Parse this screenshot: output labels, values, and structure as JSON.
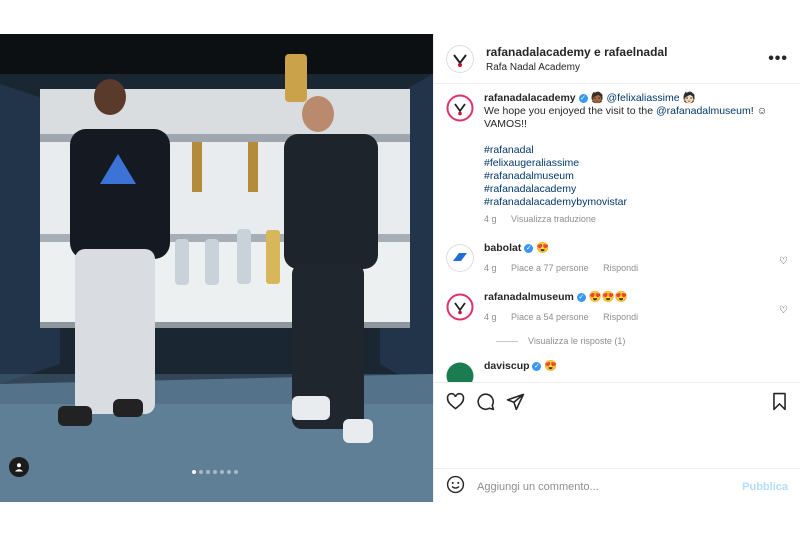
{
  "post": {
    "header": {
      "user": "rafanadalacademy e rafaelnadal",
      "subtitle": "Rafa Nadal Academy"
    },
    "caption": {
      "user": "rafanadalacademy",
      "mention": "@felixaliassime",
      "text": "We hope you enjoyed the visit to the",
      "mention2": "@rafanadalmuseum",
      "text_end": "! ☺ VAMOS!!",
      "hashtags": [
        "#rafanadal",
        "#felixaugeraliassime",
        "#rafanadalmuseum",
        "#rafanadalacademy",
        "#rafanadalacademybymovistar"
      ],
      "time": "4 g",
      "translate": "Visualizza traduzione"
    },
    "comments": [
      {
        "user": "babolat",
        "emoji": "😍",
        "time": "4 g",
        "likes": "Piace a 77 persone",
        "reply": "Rispondi"
      },
      {
        "user": "rafanadalmuseum",
        "emoji": "😍😍😍",
        "time": "4 g",
        "likes": "Piace a 54 persone",
        "reply": "Rispondi"
      },
      {
        "user": "daviscup",
        "emoji": "😍"
      }
    ],
    "view_replies": "Visualizza le risposte (1)",
    "add_comment": {
      "placeholder": "Aggiungi un commento...",
      "publish": "Pubblica"
    },
    "carousel": {
      "count": 7,
      "active": 0
    },
    "icons": {
      "like": "heart-icon",
      "comment": "comment-icon",
      "share": "share-icon",
      "save": "bookmark-icon",
      "more": "more-icon",
      "emoji": "emoji-icon",
      "tags": "user-tag-icon"
    },
    "colors": {
      "link": "#00376b",
      "verified": "#3897f0",
      "publish_disabled": "#b2dffc",
      "muted": "#8e8e8e"
    }
  }
}
